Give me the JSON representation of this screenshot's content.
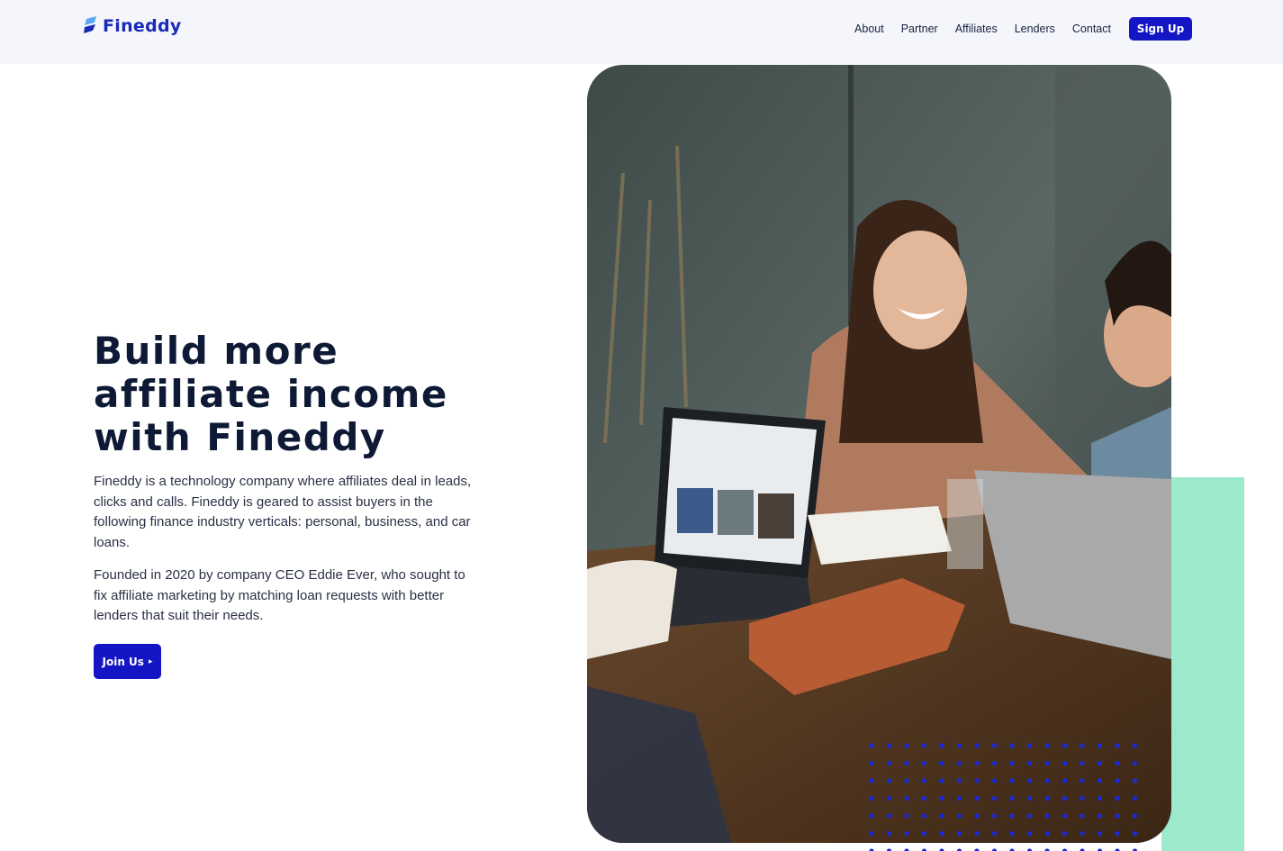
{
  "brand": {
    "name": "Fineddy",
    "accent": "#1415c4",
    "mint": "#9de9cc",
    "logo_icon": "fineddy-logo-icon"
  },
  "nav": {
    "links": [
      "About",
      "Partner",
      "Affiliates",
      "Lenders",
      "Contact"
    ],
    "signup_label": "Sign Up"
  },
  "hero": {
    "title_lines": [
      "Build more",
      "affiliate income",
      "with Fineddy"
    ],
    "paragraph_1": "Fineddy is a technology company where affiliates deal in leads, clicks and calls. Fineddy is geared to assist buyers in the following finance industry verticals: personal, business, and car loans.",
    "paragraph_2": "Founded in 2020 by company CEO Eddie Ever, who sought to fix affiliate marketing by matching loan requests with better lenders that suit their needs.",
    "cta_label": "Join Us",
    "cta_icon": "caret-right-icon",
    "photo_icon": "hero-photo-people-laptops"
  }
}
